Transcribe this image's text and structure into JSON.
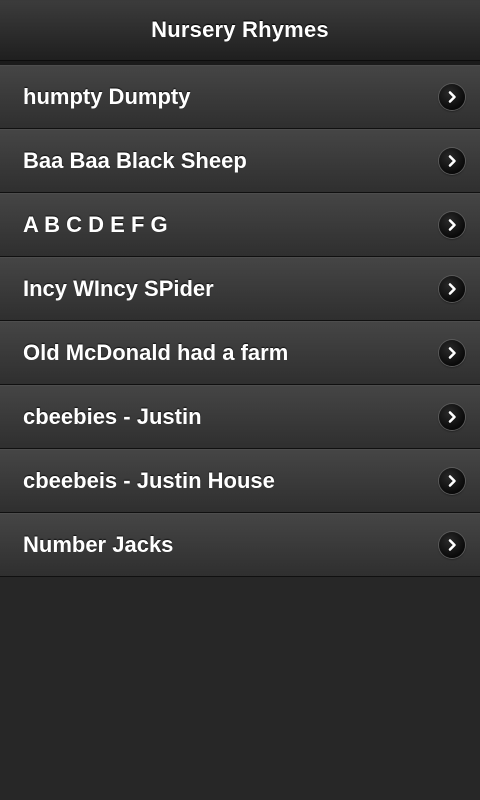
{
  "header": {
    "title": "Nursery Rhymes"
  },
  "list": {
    "items": [
      {
        "label": "humpty Dumpty",
        "icon": "chevron-right-icon"
      },
      {
        "label": "Baa Baa Black Sheep",
        "icon": "chevron-right-icon"
      },
      {
        "label": "A B C D E F G",
        "icon": "chevron-right-icon"
      },
      {
        "label": "Incy WIncy SPider",
        "icon": "chevron-right-icon"
      },
      {
        "label": "Old McDonald had a farm",
        "icon": "chevron-right-icon"
      },
      {
        "label": "cbeebies - Justin",
        "icon": "chevron-right-icon"
      },
      {
        "label": "cbeebeis - Justin House",
        "icon": "chevron-right-icon"
      },
      {
        "label": "Number Jacks",
        "icon": "chevron-right-icon"
      }
    ]
  },
  "colors": {
    "background": "#272727",
    "header_top": "#3c3c3c",
    "header_bottom": "#1f1f1f",
    "row_top": "#454545",
    "row_bottom": "#2f2f2f",
    "text": "#ffffff"
  }
}
